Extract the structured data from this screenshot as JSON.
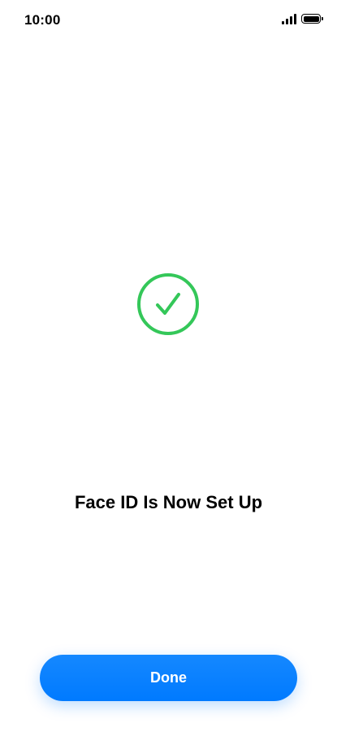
{
  "status_bar": {
    "time": "10:00",
    "icons": [
      "signal-icon",
      "battery-icon"
    ]
  },
  "main": {
    "icon": "checkmark-circle-icon",
    "title": "Face ID Is Now Set Up"
  },
  "footer": {
    "done_label": "Done"
  },
  "colors": {
    "accent": "#007AFF",
    "success": "#34C759",
    "background": "#FFFFFF",
    "text": "#000000"
  }
}
